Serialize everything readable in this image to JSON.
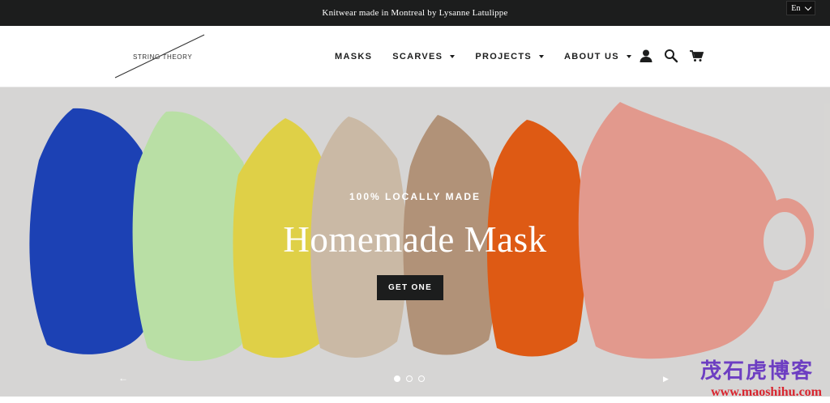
{
  "announcement": {
    "text": "Knitwear made in Montreal by Lysanne Latulippe"
  },
  "language": {
    "selected": "En"
  },
  "brand": {
    "name": "STRING THEORY"
  },
  "nav": {
    "items": [
      {
        "label": "MASKS"
      },
      {
        "label": "SCARVES"
      },
      {
        "label": "PROJECTS"
      },
      {
        "label": "ABOUT US"
      }
    ]
  },
  "icons": {
    "account": "user-icon",
    "search": "search-icon",
    "cart": "cart-icon"
  },
  "hero": {
    "subheading": "100% LOCALLY MADE",
    "title": "Homemade Mask",
    "button": "GET ONE",
    "slide_index": 1,
    "slide_count": 3,
    "mask_colors": [
      "#1f47c4",
      "#c9f2b4",
      "#f2e24e",
      "#dcc9b3",
      "#c19f83",
      "#f16216",
      "#f6a79a"
    ]
  },
  "watermark": {
    "cn": "茂石虎博客",
    "url": "www.maoshihu.com"
  }
}
